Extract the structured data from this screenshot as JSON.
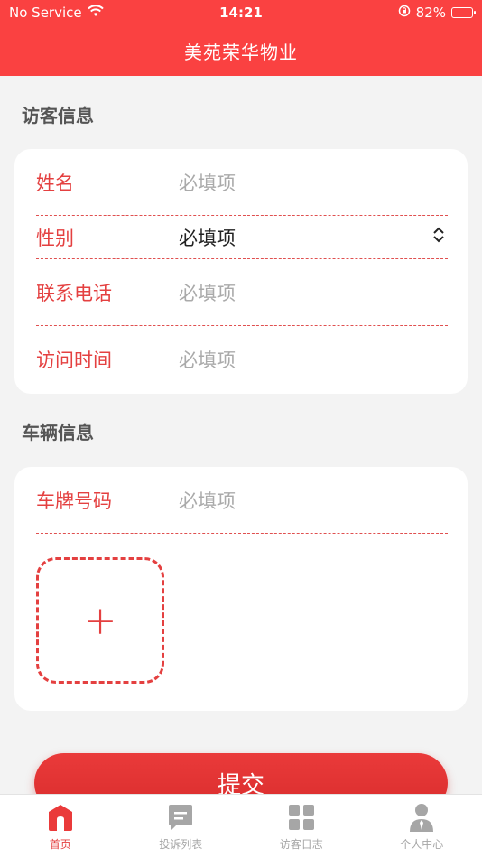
{
  "status_bar": {
    "carrier": "No Service",
    "time": "14:21",
    "battery": "82%",
    "battery_level": 0.82
  },
  "header": {
    "title": "美苑荣华物业"
  },
  "visitor_section": {
    "title": "访客信息",
    "fields": [
      {
        "label": "姓名",
        "placeholder": "必填项"
      },
      {
        "label": "性别",
        "value": "必填项"
      },
      {
        "label": "联系电话",
        "placeholder": "必填项"
      },
      {
        "label": "访问时间",
        "placeholder": "必填项"
      }
    ]
  },
  "vehicle_section": {
    "title": "车辆信息",
    "fields": [
      {
        "label": "车牌号码",
        "placeholder": "必填项"
      }
    ],
    "upload_symbol": "+"
  },
  "submit_label": "提交",
  "tabbar": {
    "tabs": [
      {
        "label": "首页",
        "icon": "home-icon",
        "active": true
      },
      {
        "label": "投诉列表",
        "icon": "message-icon",
        "active": false
      },
      {
        "label": "访客日志",
        "icon": "grid-icon",
        "active": false
      },
      {
        "label": "个人中心",
        "icon": "user-icon",
        "active": false
      }
    ]
  },
  "colors": {
    "accent": "#fa4141",
    "label": "#e44040",
    "placeholder": "#aaaaaa",
    "inactive_tab": "#a6a6a6"
  }
}
